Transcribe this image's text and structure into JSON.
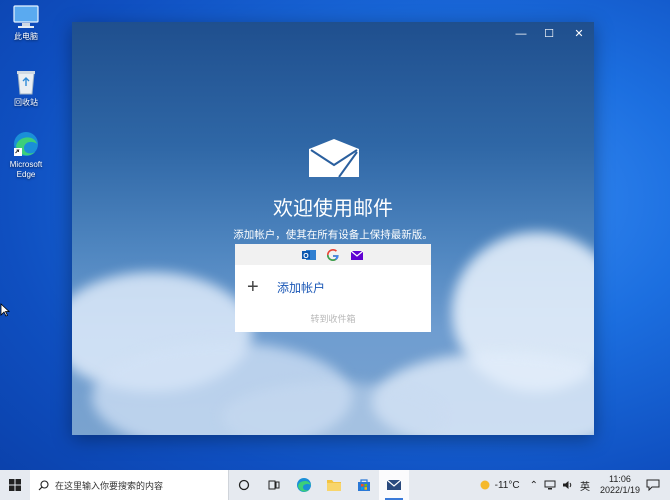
{
  "desktop": {
    "icons": [
      {
        "label": "此电脑"
      },
      {
        "label": "回收站"
      },
      {
        "label": "Microsoft Edge"
      }
    ]
  },
  "mail": {
    "welcome_title": "欢迎使用邮件",
    "subtitle": "添加帐户，使其在所有设备上保持最新版。",
    "add_account_label": "添加帐户",
    "go_to_inbox_label": "转到收件箱",
    "providers": [
      "outlook-icon",
      "google-icon",
      "yahoo-mail-icon"
    ]
  },
  "window_controls": {
    "minimize": "—",
    "maximize": "☐",
    "close": "✕"
  },
  "taskbar": {
    "search_placeholder": "在这里输入你要搜索的内容",
    "weather": "-11°C",
    "ime": "英",
    "time": "11:06",
    "date": "2022/1/19"
  },
  "colors": {
    "accent_blue": "#1a57b6",
    "desktop_bg": "#1c6fe0",
    "taskbar_bg": "#e6eaf0"
  }
}
